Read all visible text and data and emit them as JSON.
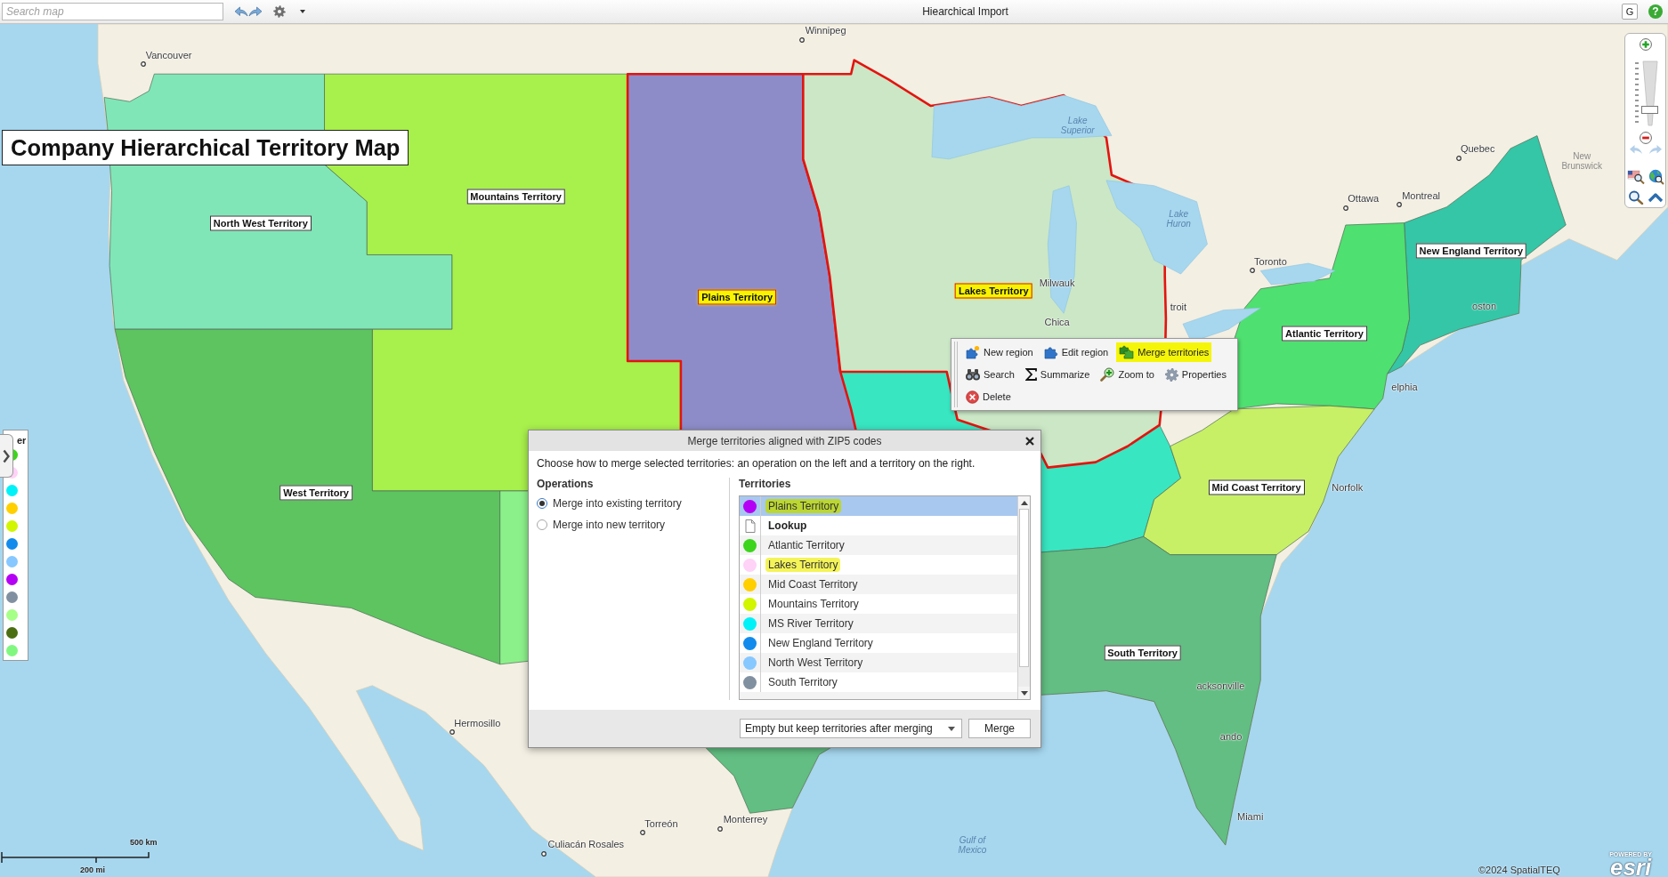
{
  "toolbar": {
    "search": {
      "placeholder": "Search map"
    },
    "title": "Hiearchical Import",
    "account_button": "G",
    "help_button": "?"
  },
  "map": {
    "title": "Company Hierarchical Territory Map",
    "territories": [
      {
        "label": "North West Territory",
        "color": "#80e6b8",
        "selected": false
      },
      {
        "label": "Mountains Territory",
        "color": "#a8f04c",
        "selected": false
      },
      {
        "label": "Plains Territory",
        "color": "#8e8cc8",
        "selected": true
      },
      {
        "label": "Lakes Territory",
        "color": "#cbe7c6",
        "selected": true
      },
      {
        "label": "New England Territory",
        "color": "#34c6a6",
        "selected": false
      },
      {
        "label": "Atlantic Territory",
        "color": "#4ee070",
        "selected": false
      },
      {
        "label": "West Territory",
        "color": "#5dc460",
        "selected": false
      },
      {
        "color": "#38e6c2",
        "selected": false
      },
      {
        "label": "Mid Coast Territory",
        "color": "#c8f066",
        "selected": false
      },
      {
        "color": "#8cf08a",
        "selected": false
      },
      {
        "label": "South Territory",
        "color": "#62be82",
        "selected": false
      }
    ],
    "places": [
      {
        "name": "Vancouver",
        "kind": "city"
      },
      {
        "name": "Winnipeg",
        "kind": "city"
      },
      {
        "name": "Lake Superior",
        "kind": "water"
      },
      {
        "name": "Quebec",
        "kind": "city"
      },
      {
        "name": "New Brunswick",
        "kind": "region"
      },
      {
        "name": "Montreal",
        "kind": "city"
      },
      {
        "name": "Ottawa",
        "kind": "city"
      },
      {
        "name": "Lake Huron",
        "kind": "water"
      },
      {
        "name": "Toronto",
        "kind": "city"
      },
      {
        "name": "Milwauk",
        "kind": "place"
      },
      {
        "name": "oston",
        "kind": "place"
      },
      {
        "name": "troit",
        "kind": "place"
      },
      {
        "name": "Chica",
        "kind": "place"
      },
      {
        "name": "elphia",
        "kind": "place"
      },
      {
        "name": "Norfolk",
        "kind": "place"
      },
      {
        "name": "acksonville",
        "kind": "place"
      },
      {
        "name": "Hermosillo",
        "kind": "city"
      },
      {
        "name": "ando",
        "kind": "place"
      },
      {
        "name": "Miami",
        "kind": "place"
      },
      {
        "name": "Torreón",
        "kind": "city"
      },
      {
        "name": "Monterrey",
        "kind": "city"
      },
      {
        "name": "Gulf of Mexico",
        "kind": "water"
      },
      {
        "name": "Culiacán Rosales",
        "kind": "city"
      }
    ],
    "scale": {
      "metric": "500 km",
      "imperial": "200 mi"
    },
    "attribution": "©2024 SpatialTEQ",
    "logo": {
      "tagline": "POWERED BY",
      "name": "esri"
    }
  },
  "legend": {
    "title": "er",
    "items": [
      {
        "color": "#3cd41c"
      },
      {
        "color": "#ffd2f7"
      },
      {
        "color": "#00f2f8"
      },
      {
        "color": "#ffcf00"
      },
      {
        "color": "#d2f500"
      },
      {
        "color": "#128bec"
      },
      {
        "color": "#86c8ff"
      },
      {
        "color": "#b400f5"
      },
      {
        "color": "#8090a0"
      },
      {
        "color": "#a6ff86"
      },
      {
        "color": "#4b6e12"
      },
      {
        "color": "#80f880"
      }
    ]
  },
  "zoom_slider": {
    "level": 0.22
  },
  "context_menu": {
    "rows": [
      [
        {
          "label": "New region",
          "highlighted": false
        },
        {
          "label": "Edit region",
          "highlighted": false
        },
        {
          "label": "Merge territories",
          "highlighted": true
        }
      ],
      [
        {
          "label": "Search",
          "highlighted": false
        },
        {
          "label": "Summarize",
          "highlighted": false
        },
        {
          "label": "Zoom to",
          "highlighted": false
        },
        {
          "label": "Properties",
          "highlighted": false
        }
      ],
      [
        {
          "label": "Delete",
          "highlighted": false
        }
      ]
    ]
  },
  "dialog": {
    "title": "Merge territories aligned with ZIP5 codes",
    "instructions": "Choose how to merge selected territories: an operation on the left and a territory on the right.",
    "operations": {
      "heading": "Operations",
      "options": [
        {
          "label": "Merge into existing territory",
          "selected": true
        },
        {
          "label": "Merge into new territory",
          "selected": false
        }
      ]
    },
    "territories": {
      "heading": "Territories",
      "items": [
        {
          "kind": "territory",
          "label": "Plains Territory",
          "color": "#b400f5",
          "selected": true,
          "highlighted": true
        },
        {
          "kind": "group",
          "label": "Lookup",
          "selected": false,
          "highlighted": false
        },
        {
          "kind": "territory",
          "label": "Atlantic Territory",
          "color": "#3cd41c",
          "selected": false,
          "highlighted": false
        },
        {
          "kind": "territory",
          "label": "Lakes Territory",
          "color": "#ffd2f7",
          "selected": false,
          "highlighted": true
        },
        {
          "kind": "territory",
          "label": "Mid Coast Territory",
          "color": "#ffcf00",
          "selected": false,
          "highlighted": false
        },
        {
          "kind": "territory",
          "label": "Mountains Territory",
          "color": "#d2f500",
          "selected": false,
          "highlighted": false
        },
        {
          "kind": "territory",
          "label": "MS River Territory",
          "color": "#00f2f8",
          "selected": false,
          "highlighted": false
        },
        {
          "kind": "territory",
          "label": "New England Territory",
          "color": "#128bec",
          "selected": false,
          "highlighted": false
        },
        {
          "kind": "territory",
          "label": "North West Territory",
          "color": "#86c8ff",
          "selected": false,
          "highlighted": false
        },
        {
          "kind": "territory",
          "label": "South Territory",
          "color": "#8090a0",
          "selected": false,
          "highlighted": false
        }
      ]
    },
    "mode": {
      "value": "Empty but keep territories after merging"
    },
    "merge_button": "Merge"
  }
}
